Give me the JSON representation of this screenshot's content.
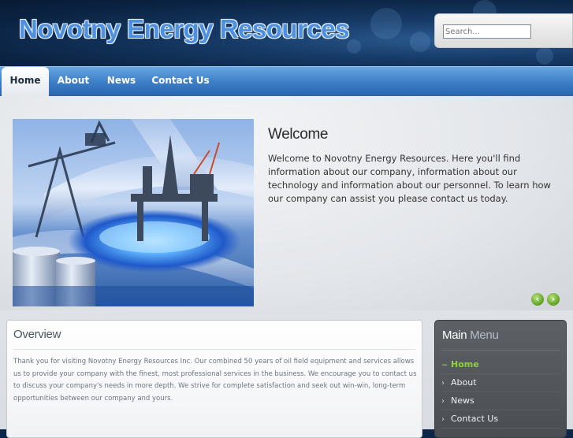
{
  "header": {
    "site_title": "Novotny Energy Resources",
    "search_placeholder": "Search..."
  },
  "nav": {
    "items": [
      {
        "label": "Home",
        "active": true
      },
      {
        "label": "About",
        "active": false
      },
      {
        "label": "News",
        "active": false
      },
      {
        "label": "Contact Us",
        "active": false
      }
    ]
  },
  "slideshow": {
    "title": "Welcome",
    "text": "Welcome to Novotny Energy Resources. Here you'll find information about our company, information about our technology and information about our personnel. To learn how our company can assist you please contact us today.",
    "prev_icon": "chevron-left-icon",
    "next_icon": "chevron-right-icon",
    "prev_glyph": "‹",
    "next_glyph": "›"
  },
  "overview": {
    "title": "Overview",
    "text": "Thank you for visiting Novotny Energy Resources Inc. Our combined 50 years of oil field equipment and services allows us to provide your company with the finest, most professional services in the business. We encourage you to contact us to discuss your company's needs in more depth. We strive for complete satisfaction and seek out win-win, long-term opportunities between our company and yours."
  },
  "main_menu": {
    "title_word1": "Main",
    "title_word2": "Menu",
    "chevron_glyph": "›",
    "current_glyph": "~",
    "items": [
      {
        "label": "Home",
        "current": true
      },
      {
        "label": "About",
        "current": false
      },
      {
        "label": "News",
        "current": false
      },
      {
        "label": "Contact Us",
        "current": false
      }
    ]
  },
  "colors": {
    "nav_blue": "#3d7fc7",
    "title_blue": "#4d8fe0",
    "menu_green": "#8fd13a",
    "arrow_green": "#5f9f22"
  }
}
